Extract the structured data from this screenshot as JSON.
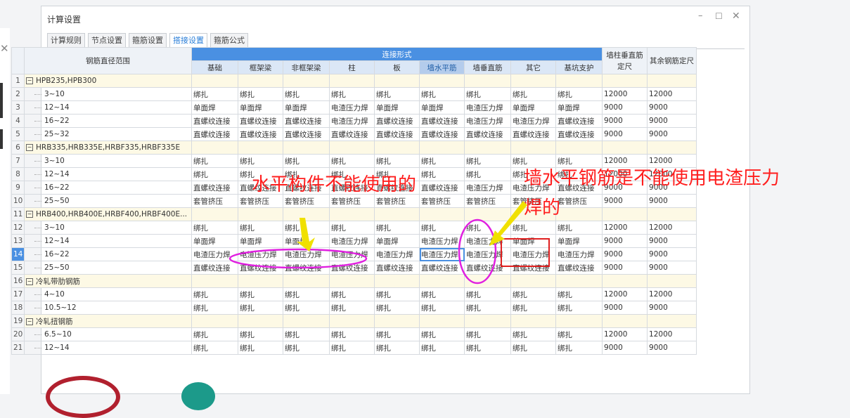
{
  "dialog": {
    "title": "计算设置",
    "min_icon": "minimize-icon",
    "max_icon": "maximize-icon",
    "close_icon": "close-icon"
  },
  "tabs": [
    "计算规则",
    "节点设置",
    "箍筋设置",
    "搭接设置",
    "箍筋公式"
  ],
  "active_tab": 3,
  "table": {
    "header_range": "钢筋直径范围",
    "header_conn": "连接形式",
    "header_wall": "墙柱垂直筋定尺",
    "header_other": "其余钢筋定尺",
    "conn_cols": [
      "基础",
      "框架梁",
      "非框架梁",
      "柱",
      "板",
      "墙水平筋",
      "墙垂直筋",
      "其它",
      "基坑支护"
    ],
    "rows": [
      {
        "n": "1",
        "group": "HPB235,HPB300"
      },
      {
        "n": "2",
        "range": "3~10",
        "c": [
          "绑扎",
          "绑扎",
          "绑扎",
          "绑扎",
          "绑扎",
          "绑扎",
          "绑扎",
          "绑扎",
          "绑扎"
        ],
        "w": "12000",
        "o": "12000"
      },
      {
        "n": "3",
        "range": "12~14",
        "c": [
          "单面焊",
          "单面焊",
          "单面焊",
          "电渣压力焊",
          "单面焊",
          "单面焊",
          "电渣压力焊",
          "单面焊",
          "单面焊"
        ],
        "w": "9000",
        "o": "9000"
      },
      {
        "n": "4",
        "range": "16~22",
        "c": [
          "直螺纹连接",
          "直螺纹连接",
          "直螺纹连接",
          "电渣压力焊",
          "直螺纹连接",
          "直螺纹连接",
          "电渣压力焊",
          "电渣压力焊",
          "直螺纹连接"
        ],
        "w": "9000",
        "o": "9000"
      },
      {
        "n": "5",
        "range": "25~32",
        "c": [
          "直螺纹连接",
          "直螺纹连接",
          "直螺纹连接",
          "直螺纹连接",
          "直螺纹连接",
          "直螺纹连接",
          "直螺纹连接",
          "直螺纹连接",
          "直螺纹连接"
        ],
        "w": "9000",
        "o": "9000"
      },
      {
        "n": "6",
        "group": "HRB335,HRB335E,HRBF335,HRBF335E"
      },
      {
        "n": "7",
        "range": "3~10",
        "c": [
          "绑扎",
          "绑扎",
          "绑扎",
          "绑扎",
          "绑扎",
          "绑扎",
          "绑扎",
          "绑扎",
          "绑扎"
        ],
        "w": "12000",
        "o": "12000"
      },
      {
        "n": "8",
        "range": "12~14",
        "c": [
          "绑扎",
          "绑扎",
          "绑扎",
          "绑扎",
          "绑扎",
          "绑扎",
          "绑扎",
          "绑扎",
          "绑扎"
        ],
        "w": "12000",
        "o": "12000"
      },
      {
        "n": "9",
        "range": "16~22",
        "c": [
          "直螺纹连接",
          "直螺纹连接",
          "直螺纹连接",
          "直螺纹连接",
          "直螺纹连接",
          "直螺纹连接",
          "电渣压力焊",
          "电渣压力焊",
          "直螺纹连接"
        ],
        "w": "9000",
        "o": "9000"
      },
      {
        "n": "10",
        "range": "25~50",
        "c": [
          "套管挤压",
          "套管挤压",
          "套管挤压",
          "套管挤压",
          "套管挤压",
          "套管挤压",
          "套管挤压",
          "套管挤压",
          "套管挤压"
        ],
        "w": "9000",
        "o": "9000"
      },
      {
        "n": "11",
        "group": "HRB400,HRB400E,HRBF400,HRBF400E..."
      },
      {
        "n": "12",
        "range": "3~10",
        "c": [
          "绑扎",
          "绑扎",
          "绑扎",
          "绑扎",
          "绑扎",
          "绑扎",
          "绑扎",
          "绑扎",
          "绑扎"
        ],
        "w": "12000",
        "o": "12000"
      },
      {
        "n": "13",
        "range": "12~14",
        "c": [
          "单面焊",
          "单面焊",
          "单面焊",
          "电渣压力焊",
          "单面焊",
          "电渣压力焊",
          "电渣压力焊",
          "单面焊",
          "单面焊"
        ],
        "w": "9000",
        "o": "9000"
      },
      {
        "n": "14",
        "range": "16~22",
        "c": [
          "电渣压力焊",
          "电渣压力焊",
          "电渣压力焊",
          "电渣压力焊",
          "电渣压力焊",
          "电渣压力焊",
          "电渣压力焊",
          "电渣压力焊",
          "电渣压力焊"
        ],
        "w": "9000",
        "o": "9000",
        "selected": true
      },
      {
        "n": "15",
        "range": "25~50",
        "c": [
          "直螺纹连接",
          "直螺纹连接",
          "直螺纹连接",
          "直螺纹连接",
          "直螺纹连接",
          "直螺纹连接",
          "直螺纹连接",
          "直螺纹连接",
          "直螺纹连接"
        ],
        "w": "9000",
        "o": "9000"
      },
      {
        "n": "16",
        "group": "冷轧带肋钢筋"
      },
      {
        "n": "17",
        "range": "4~10",
        "c": [
          "绑扎",
          "绑扎",
          "绑扎",
          "绑扎",
          "绑扎",
          "绑扎",
          "绑扎",
          "绑扎",
          "绑扎"
        ],
        "w": "12000",
        "o": "12000"
      },
      {
        "n": "18",
        "range": "10.5~12",
        "c": [
          "绑扎",
          "绑扎",
          "绑扎",
          "绑扎",
          "绑扎",
          "绑扎",
          "绑扎",
          "绑扎",
          "绑扎"
        ],
        "w": "9000",
        "o": "9000"
      },
      {
        "n": "19",
        "group": "冷轧扭钢筋"
      },
      {
        "n": "20",
        "range": "6.5~10",
        "c": [
          "绑扎",
          "绑扎",
          "绑扎",
          "绑扎",
          "绑扎",
          "绑扎",
          "绑扎",
          "绑扎",
          "绑扎"
        ],
        "w": "12000",
        "o": "12000"
      },
      {
        "n": "21",
        "range": "12~14",
        "c": [
          "绑扎",
          "绑扎",
          "绑扎",
          "绑扎",
          "绑扎",
          "绑扎",
          "绑扎",
          "绑扎",
          "绑扎"
        ],
        "w": "9000",
        "o": "9000"
      }
    ]
  },
  "annotations": {
    "left_text": "水平构件不能使用的",
    "right_text_line1": "墙水平钢筋是不能使用电渣压力",
    "right_text_line2": "焊的",
    "text_color": "#ff1e1e",
    "ellipse_color": "#e020e0",
    "arrow_color": "#f0e000",
    "rect_color": "#e02020"
  },
  "background": {
    "close_icon": "close-icon"
  }
}
